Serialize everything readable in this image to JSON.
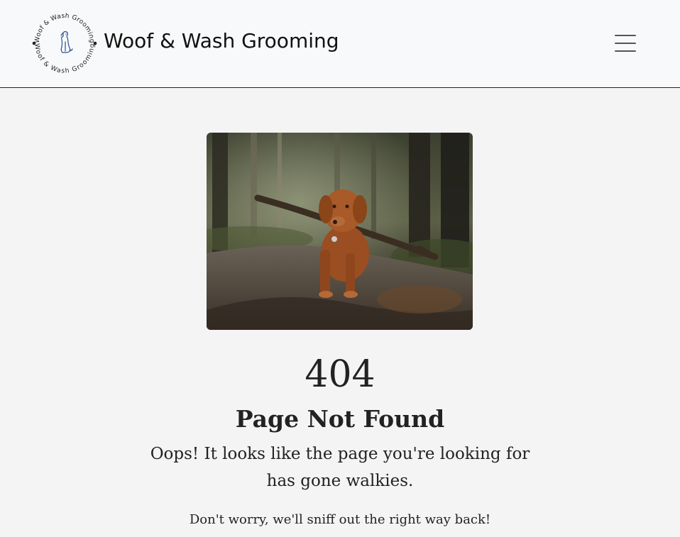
{
  "navbar": {
    "brand": "Woof & Wash Grooming",
    "logo_ring_text": "Woof & Wash Grooming",
    "menu_icon": "hamburger-menu-icon"
  },
  "main": {
    "image_subject": "dog-with-stick-photo",
    "code": "404",
    "title": "Page Not Found",
    "message": "Oops! It looks like the page you're looking for has gone walkies.",
    "submessage": "Don't worry, we'll sniff out the right way back!"
  },
  "colors": {
    "navbar_bg": "#f8f9fa",
    "page_bg": "#f4f4f4",
    "text": "#222222",
    "logo_accent": "#2b4f8f"
  }
}
